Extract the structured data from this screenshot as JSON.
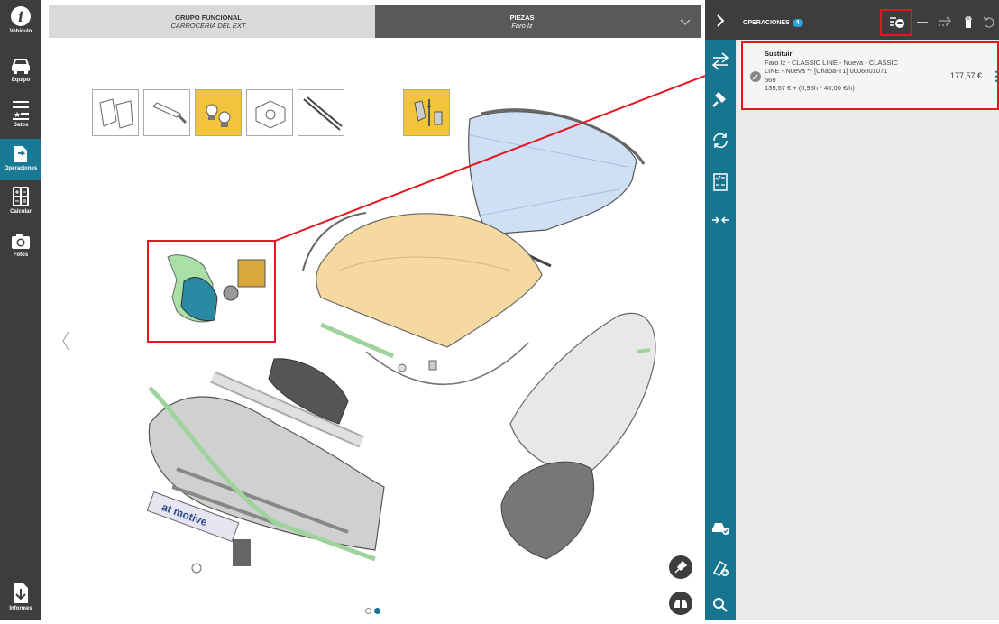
{
  "nav": {
    "items": [
      {
        "label": "Vehículo",
        "icon": "info-icon"
      },
      {
        "label": "Equipo",
        "icon": "car-icon"
      },
      {
        "label": "Datos",
        "icon": "data-list-icon"
      },
      {
        "label": "Operaciones",
        "icon": "operations-icon"
      },
      {
        "label": "Calcular",
        "icon": "calculator-icon"
      },
      {
        "label": "Fotos",
        "icon": "camera-icon"
      },
      {
        "label": "Informes",
        "icon": "download-report-icon"
      }
    ]
  },
  "header": {
    "group_title": "GRUPO FUNCIONAL",
    "group_value": "CARROCERIA DEL EXT",
    "parts_title": "PIEZAS",
    "parts_value": "Faro Iz"
  },
  "diagram": {
    "watermark": "at motive",
    "carousel_pages": 2,
    "active_page": 2
  },
  "side_tools": [
    "swap-icon",
    "hammer-icon",
    "refresh-icon",
    "checklist-icon",
    "merge-arrows-icon",
    "car-check-icon",
    "car-add-icon",
    "search-icon"
  ],
  "operations": {
    "title": "OPERACIONES",
    "count": "4",
    "item": {
      "title": "Sustituir",
      "line1": "Faro Iz - CLASSIC LINE - Nueva - CLASSIC",
      "line2": "LINE - Nueva ** [Chapa-T1] 0006001071",
      "line3": "569",
      "line4": "139,57 € + (0,95h * 40,00 €/h)",
      "price": "177,57 €"
    }
  },
  "colors": {
    "accent": "#17758f",
    "highlight": "#e4161f",
    "part_yellow": "#f2c43c",
    "dark": "#3d3d3d"
  }
}
